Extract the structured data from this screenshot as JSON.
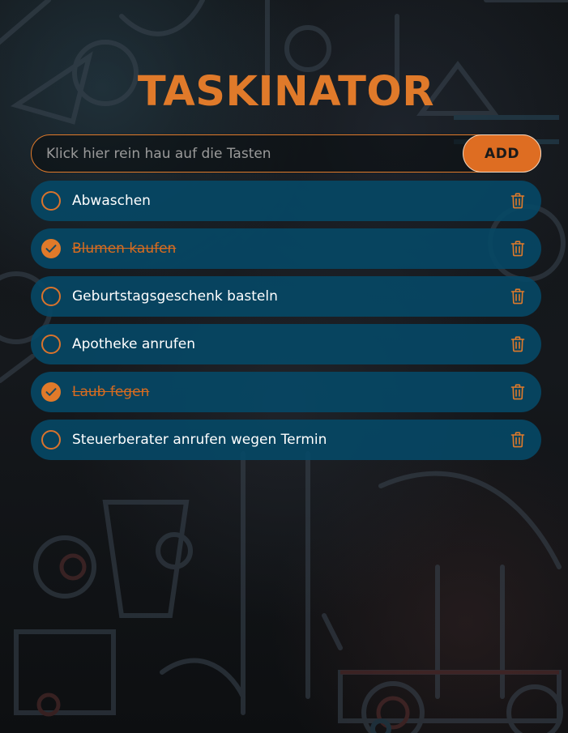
{
  "app": {
    "title": "TASKINATOR"
  },
  "new_task": {
    "placeholder": "Klick hier rein hau auf die Tasten",
    "value": "",
    "add_label": "ADD"
  },
  "tasks": [
    {
      "text": "Abwaschen",
      "done": false
    },
    {
      "text": "Blumen kaufen",
      "done": true
    },
    {
      "text": "Geburtstagsgeschenk basteln",
      "done": false
    },
    {
      "text": "Apotheke anrufen",
      "done": false
    },
    {
      "text": "Laub fegen",
      "done": true
    },
    {
      "text": "Steuerberater anrufen wegen Termin",
      "done": false
    }
  ],
  "icons": {
    "check": "check-icon",
    "delete": "trash-icon"
  },
  "colors": {
    "accent": "#e07a2a",
    "task_background": "#064866",
    "page_background": "#121518",
    "task_text": "#ffffff"
  }
}
